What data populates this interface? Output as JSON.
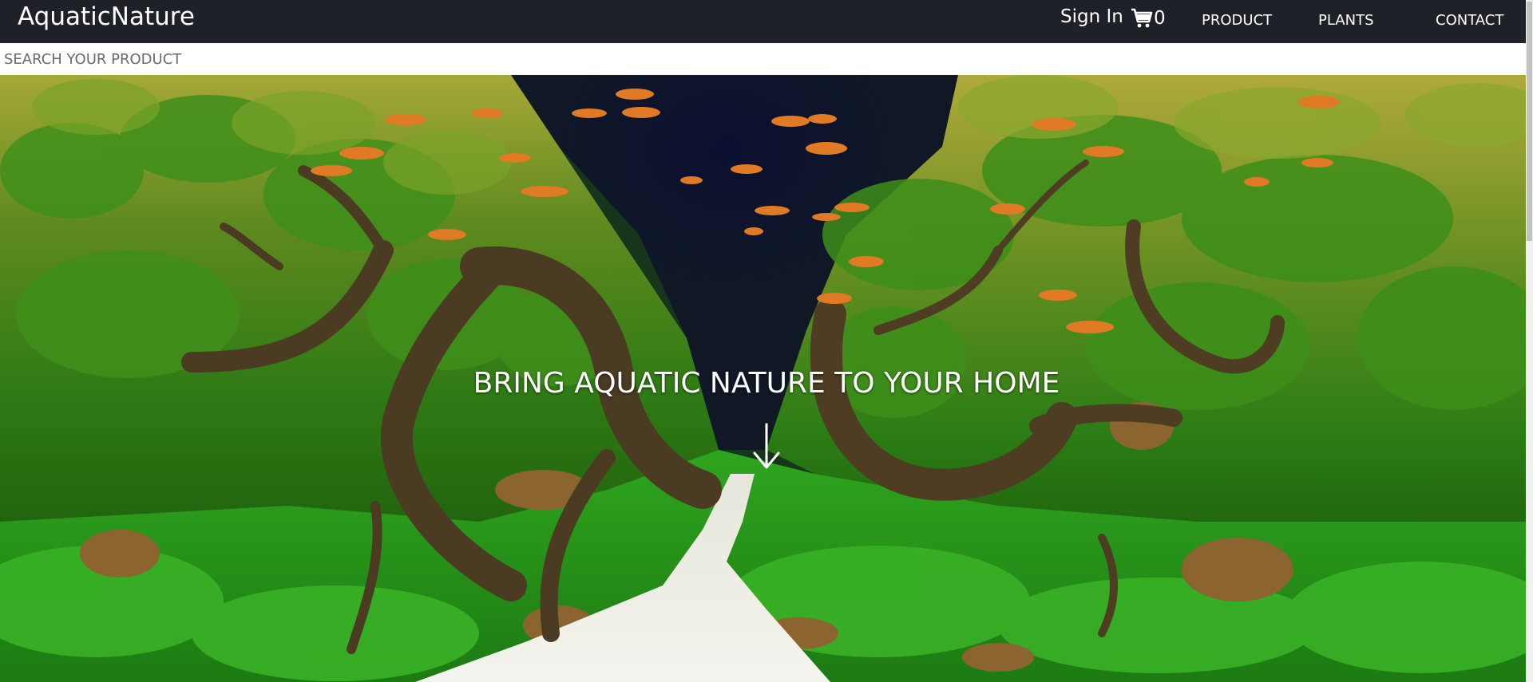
{
  "navbar": {
    "brand": "AquaticNature",
    "signin_label": "Sign In",
    "cart_count": "0",
    "links": [
      "PRODUCT",
      "PLANTS",
      "CONTACT"
    ]
  },
  "search": {
    "placeholder": "SEARCH YOUR PRODUCT"
  },
  "hero": {
    "headline": "BRING AQUATIC NATURE TO YOUR HOME",
    "arrow_icon": "arrow-down-icon",
    "image_subject": "planted aquarium aquascape with driftwood, sand path and orange fish"
  },
  "icons": {
    "cart": "shopping-cart-icon"
  },
  "colors": {
    "navbar_bg": "#1f2128",
    "text": "#ffffff",
    "search_bg": "#ffffff"
  }
}
